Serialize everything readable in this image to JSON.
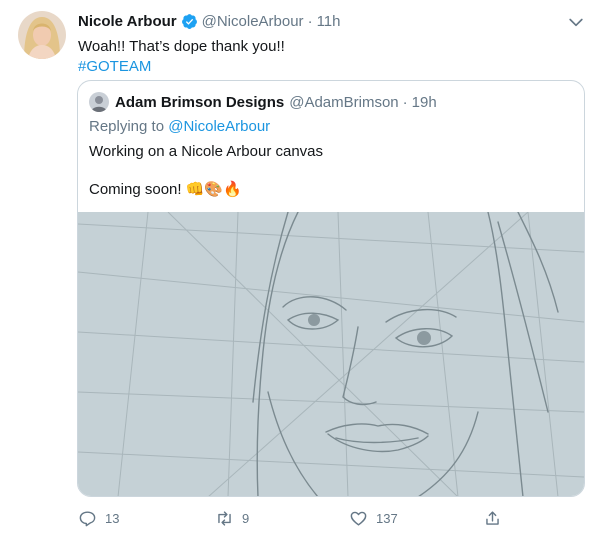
{
  "tweet": {
    "author_name": "Nicole Arbour",
    "author_handle": "@NicoleArbour",
    "separator": "·",
    "time": "11h",
    "text_line1": "Woah!! That’s dope thank you!!",
    "hashtag": "#GOTEAM"
  },
  "quote": {
    "author_name": "Adam Brimson Designs",
    "author_handle": "@AdamBrimson",
    "separator": "·",
    "time": "19h",
    "replying_prefix": "Replying to",
    "replying_to": "@NicoleArbour",
    "text_para1": "Working on a Nicole Arbour canvas",
    "text_para2": "Coming soon! ",
    "emojis": "👊🎨🔥"
  },
  "actions": {
    "reply_count": "13",
    "retweet_count": "9",
    "like_count": "137"
  },
  "colors": {
    "accent": "#1b95e0",
    "secondary_text": "#657786",
    "border": "#ccd6dd"
  },
  "icons": [
    "verified-badge-icon",
    "chevron-down-icon",
    "reply-icon",
    "retweet-icon",
    "like-icon",
    "share-icon"
  ]
}
